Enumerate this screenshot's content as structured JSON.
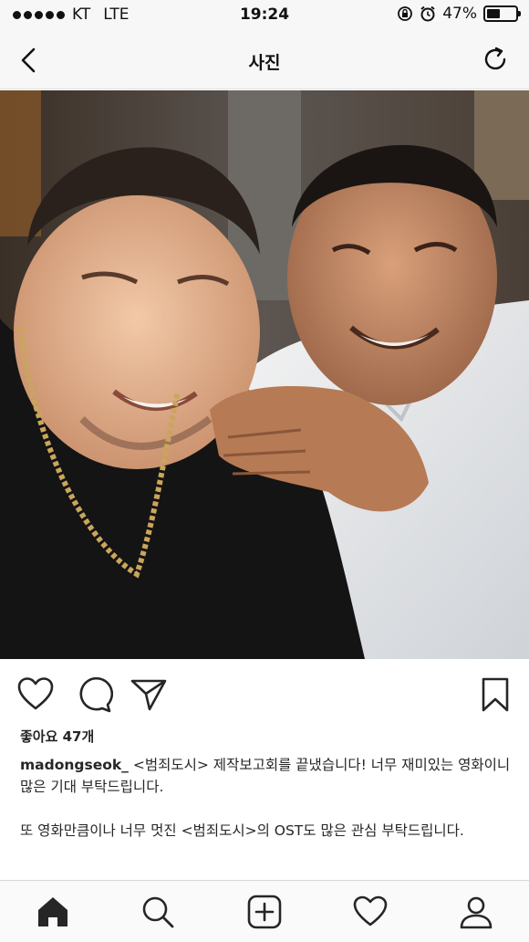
{
  "status_bar": {
    "carrier": "KT",
    "network": "LTE",
    "time": "19:24",
    "battery_percent": "47%",
    "battery_level": 0.47,
    "icons": [
      "signal-icon",
      "rotation-lock-icon",
      "alarm-icon",
      "battery-icon"
    ]
  },
  "nav": {
    "title": "사진",
    "back_icon": "chevron-left-icon",
    "refresh_icon": "refresh-icon"
  },
  "post": {
    "likes": "좋아요 47개",
    "username": "madongseok_",
    "caption_line1": " <범죄도시> 제작보고회를 끝냈습니다! 너무 재미있는 영화이니 많은 기대 부탁드립니다.",
    "caption_line2": "또 영화만큼이나 너무 멋진 <범죄도시>의 OST도 많은 관심 부탁드립니다.",
    "actions": [
      "heart-icon",
      "comment-icon",
      "share-icon",
      "bookmark-icon"
    ]
  },
  "tab_bar": {
    "items": [
      "home-icon",
      "search-icon",
      "add-post-icon",
      "activity-heart-icon",
      "profile-icon"
    ],
    "active": "home-icon"
  },
  "colors": {
    "text": "#262626",
    "bar_background": "#f7f7f7",
    "divider": "#dcdcdc"
  }
}
